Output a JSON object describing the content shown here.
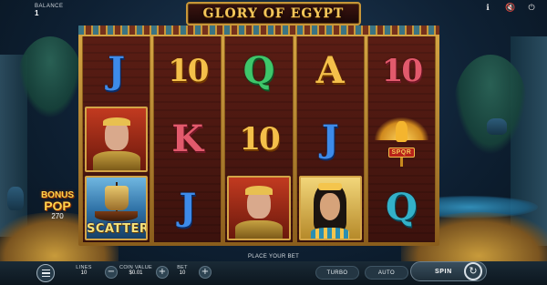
{
  "game": {
    "title": "GLORY OF EGYPT"
  },
  "balance": {
    "label": "BALANCE",
    "value": "1"
  },
  "top_icons": [
    "info-icon",
    "sound-icon",
    "settings-icon"
  ],
  "reels": [
    [
      "J",
      "caesar",
      "scatter"
    ],
    [
      "10",
      "K",
      "J"
    ],
    [
      "Q",
      "10",
      "caesar"
    ],
    [
      "A",
      "J",
      "cleopatra"
    ],
    [
      "10",
      "eagle",
      "Q"
    ]
  ],
  "symbols": {
    "scatter_label": "SCATTER",
    "eagle_plaque": "SPQR"
  },
  "bonus_pop": {
    "line1": "BONUS",
    "line2": "POP",
    "amount": "270"
  },
  "message": "PLACE YOUR BET",
  "controls": {
    "lines_label": "LINES",
    "lines_value": "10",
    "coin_label": "COIN VALUE",
    "coin_value": "$0.01",
    "bet_label": "BET",
    "bet_value": "10",
    "turbo_label": "TURBO",
    "auto_label": "AUTO",
    "spin_label": "SPIN"
  }
}
